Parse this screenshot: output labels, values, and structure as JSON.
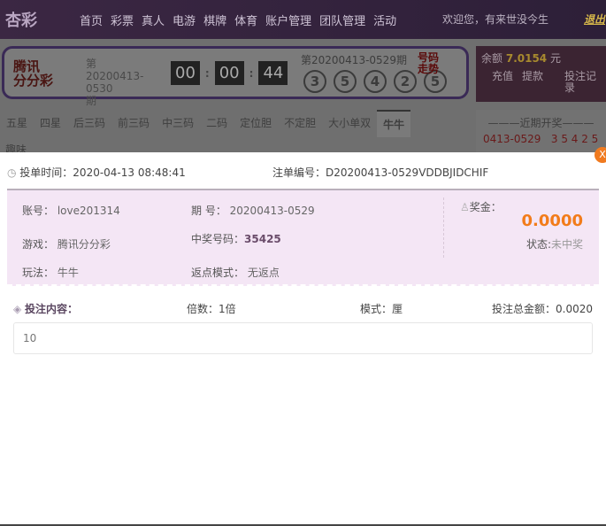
{
  "header": {
    "logo": "杏彩",
    "nav": [
      "首页",
      "彩票",
      "真人",
      "电游",
      "棋牌",
      "体育",
      "账户管理",
      "团队管理",
      "活动"
    ],
    "welcome": "欢迎您，有来世没今生",
    "logout": "退出"
  },
  "game": {
    "logo_line1": "腾讯",
    "logo_line2": "分分彩",
    "period_prefix": "第",
    "period": "20200413-0530",
    "period_suffix": "期",
    "timer": [
      "00",
      "00",
      "44"
    ],
    "last_period": "第20200413-0529期",
    "last_numbers": [
      "3",
      "5",
      "4",
      "2",
      "5"
    ],
    "trend_line1": "号码",
    "trend_line2": "走势"
  },
  "account": {
    "balance_label": "余额",
    "balance": "7.0154",
    "unit": "元",
    "recharge": "充值",
    "withdraw": "提款",
    "records": "投注记录"
  },
  "tabs": [
    "五星",
    "四星",
    "后三码",
    "前三码",
    "中三码",
    "二码",
    "定位胆",
    "不定胆",
    "大小单双",
    "牛牛"
  ],
  "fun_tab": "趣味",
  "recent": {
    "title": "———近期开奖———",
    "period": "0413-0529",
    "numbers": "3 5 4 2 5"
  },
  "modal": {
    "close": "X",
    "bet_time": "投单时间：2020-04-13 08:48:41",
    "order_no": "注单编号：D20200413-0529VDDBJIDCHIF",
    "account_label": "账号：",
    "account": "love201314",
    "period_label": "期 号：",
    "period": "20200413-0529",
    "game_label": "游戏：",
    "game": "腾讯分分彩",
    "win_label": "中奖号码：",
    "win_numbers": "35425",
    "play_label": "玩法：",
    "play": "牛牛",
    "rebate_label": "返点模式：",
    "rebate": "无返点",
    "prize_label": "奖金：",
    "prize": "0.0000",
    "status_label": "状态:",
    "status": "未中奖",
    "content_label": "投注内容：",
    "multiple": "倍数：1倍",
    "mode": "模式：厘",
    "total": "投注总金额：0.0020",
    "content": "10"
  }
}
